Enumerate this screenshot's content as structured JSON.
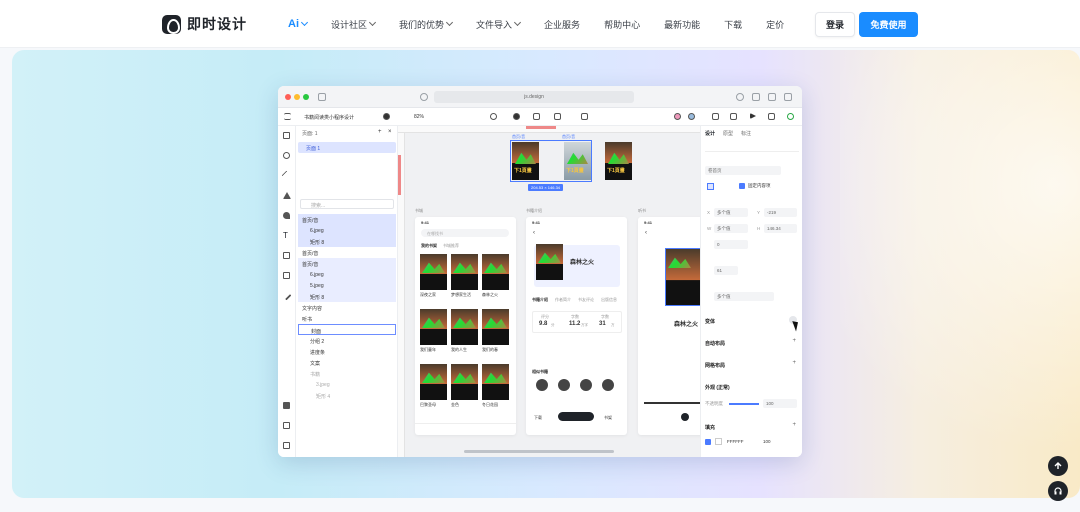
{
  "brand": {
    "name": "即时设计"
  },
  "nav": {
    "items": [
      {
        "label": "Ai",
        "has_dropdown": true
      },
      {
        "label": "设计社区",
        "has_dropdown": true
      },
      {
        "label": "我们的优势",
        "has_dropdown": true
      },
      {
        "label": "文件导入",
        "has_dropdown": true
      },
      {
        "label": "企业服务",
        "has_dropdown": false
      },
      {
        "label": "帮助中心",
        "has_dropdown": false
      },
      {
        "label": "最新功能",
        "has_dropdown": false
      },
      {
        "label": "下载",
        "has_dropdown": false
      },
      {
        "label": "定价",
        "has_dropdown": false
      }
    ],
    "login_label": "登录",
    "free_label": "免费使用"
  },
  "colors": {
    "accent": "#1a8cff",
    "selection": "#4b7bff"
  },
  "app": {
    "url": "js.design",
    "project_name": "书籍阅读类小程序设计",
    "zoom": "82%",
    "pages_header": "页面: 1",
    "page1": "页面 1",
    "search_placeholder": "搜索...",
    "layers": [
      {
        "label": "首页/音",
        "state": "sel"
      },
      {
        "label": "6.jpeg",
        "state": "sel"
      },
      {
        "label": "矩形 8",
        "state": "sel"
      },
      {
        "label": "首页/音",
        "state": ""
      },
      {
        "label": "首页/音",
        "state": "hi"
      },
      {
        "label": "6.jpeg",
        "state": "hi"
      },
      {
        "label": "5.jpeg",
        "state": "hi"
      },
      {
        "label": "矩形 8",
        "state": "hi"
      },
      {
        "label": "文字内容",
        "state": ""
      },
      {
        "label": "听书",
        "state": ""
      },
      {
        "label": "封面",
        "state": "out"
      },
      {
        "label": "分组 2",
        "state": ""
      },
      {
        "label": "进度条",
        "state": ""
      },
      {
        "label": "文案",
        "state": ""
      },
      {
        "label": "书籍",
        "state": ""
      },
      {
        "label": "3.jpeg",
        "state": ""
      },
      {
        "label": "矩形 4",
        "state": ""
      }
    ],
    "canvas": {
      "sel_label_1": "首页/音",
      "sel_label_2": "首页/音",
      "dim_tag": "204.53 × 146.34",
      "frame_labels": [
        "书城",
        "书籍介绍",
        "听书"
      ],
      "phone1": {
        "time": "9:41",
        "search": "在哪找书",
        "tab_1": "我的书架",
        "tab_2": "书城推荐",
        "books": [
          "深夜之家",
          "梦想家生活",
          "森林之火",
          "我们童年",
          "我的人生",
          "我们的春",
          "巴黎圣母",
          "金色",
          "冬日花园"
        ]
      },
      "phone2": {
        "time": "9:41",
        "title": "森林之火",
        "tabs": [
          "书籍介绍",
          "作者简介",
          "书友评论",
          "出版信息"
        ],
        "stat_labels": [
          "评分",
          "字数",
          "字数"
        ],
        "stats": [
          "9.8",
          "11.2",
          "31"
        ],
        "stat_units": [
          "分",
          "万字",
          "万"
        ],
        "section": "相似书籍",
        "bottom_left": "下载",
        "bottom_right": "书架"
      },
      "phone3": {
        "time": "9:41",
        "title": "森林之火"
      }
    },
    "props": {
      "tabs": [
        "设计",
        "原型",
        "标注"
      ],
      "component": "卷首页",
      "checkbox_label": "固定内容项",
      "x_label": "X",
      "x_value": "多个值",
      "y_label": "Y",
      "y_value": "-219",
      "w_label": "W",
      "w_value": "多个值",
      "h_label": "H",
      "h_value": "146.34",
      "rotate": "0",
      "radius": "61",
      "corner": "多个值",
      "sections": [
        "变体",
        "自动布局",
        "网格布局",
        "外观 (正常)",
        "填充"
      ],
      "opacity_label": "不透明度",
      "opacity_value": "100",
      "fill_hex": "FFFFFF",
      "fill_opacity": "100"
    }
  }
}
